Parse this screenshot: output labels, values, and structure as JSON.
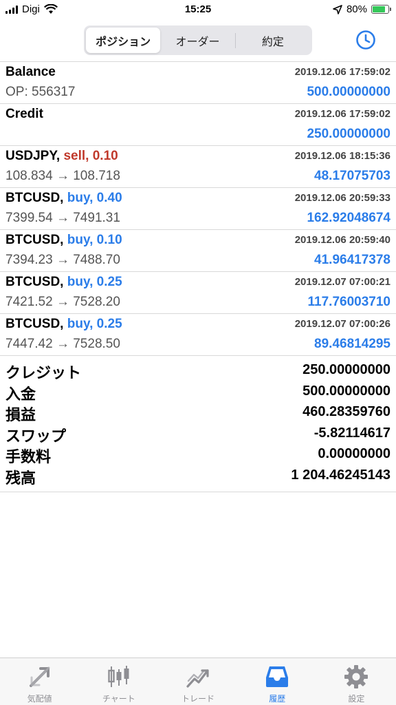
{
  "status_bar": {
    "carrier": "Digi",
    "time": "15:25",
    "battery": "80%"
  },
  "segments": [
    {
      "label": "ポジション",
      "active": true
    },
    {
      "label": "オーダー",
      "active": false
    },
    {
      "label": "約定",
      "active": false
    }
  ],
  "deals": [
    {
      "symbol": "Balance",
      "side": "",
      "date": "2019.12.06 17:59:02",
      "sub": "OP: 556317",
      "amount": "500.00000000"
    },
    {
      "symbol": "Credit",
      "side": "",
      "date": "2019.12.06 17:59:02",
      "sub": "",
      "amount": "250.00000000"
    },
    {
      "symbol": "USDJPY,",
      "side": "sell, 0.10",
      "side_type": "sell",
      "date": "2019.12.06 18:15:36",
      "sub": "108.834 → 108.718",
      "amount": "48.17075703"
    },
    {
      "symbol": "BTCUSD,",
      "side": "buy, 0.40",
      "side_type": "buy",
      "date": "2019.12.06 20:59:33",
      "sub": "7399.54 → 7491.31",
      "amount": "162.92048674"
    },
    {
      "symbol": "BTCUSD,",
      "side": "buy, 0.10",
      "side_type": "buy",
      "date": "2019.12.06 20:59:40",
      "sub": "7394.23 → 7488.70",
      "amount": "41.96417378"
    },
    {
      "symbol": "BTCUSD,",
      "side": "buy, 0.25",
      "side_type": "buy",
      "date": "2019.12.07 07:00:21",
      "sub": "7421.52 → 7528.20",
      "amount": "117.76003710"
    },
    {
      "symbol": "BTCUSD,",
      "side": "buy, 0.25",
      "side_type": "buy",
      "date": "2019.12.07 07:00:26",
      "sub": "7447.42 → 7528.50",
      "amount": "89.46814295"
    }
  ],
  "summary": [
    {
      "label": "クレジット",
      "value": "250.00000000"
    },
    {
      "label": "入金",
      "value": "500.00000000"
    },
    {
      "label": "損益",
      "value": "460.28359760"
    },
    {
      "label": "スワップ",
      "value": "-5.82114617"
    },
    {
      "label": "手数料",
      "value": "0.00000000"
    },
    {
      "label": "残高",
      "value": "1 204.46245143"
    }
  ],
  "tabs": [
    {
      "label": "気配値",
      "icon": "quotes-icon",
      "active": false
    },
    {
      "label": "チャート",
      "icon": "chart-icon",
      "active": false
    },
    {
      "label": "トレード",
      "icon": "trade-icon",
      "active": false
    },
    {
      "label": "履歴",
      "icon": "history-icon",
      "active": true
    },
    {
      "label": "設定",
      "icon": "settings-icon",
      "active": false
    }
  ],
  "colors": {
    "accent": "#2b7de9",
    "sell": "#c0392b",
    "buy": "#2b7de9",
    "battery": "#34c759"
  }
}
